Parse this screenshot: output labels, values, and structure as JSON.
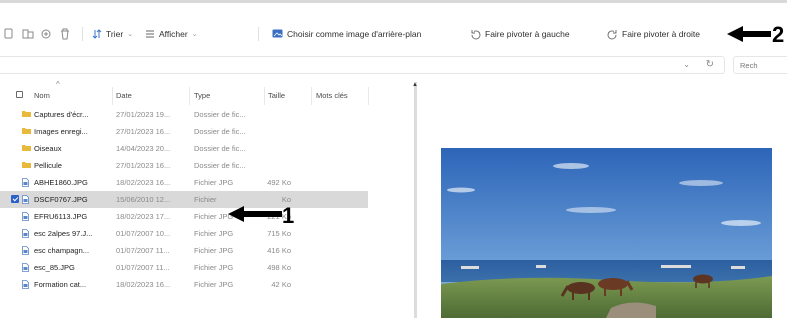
{
  "toolbar": {
    "sort_label": "Trier",
    "view_label": "Afficher",
    "set_background_label": "Choisir comme image d'arrière-plan",
    "rotate_left_label": "Faire pivoter à gauche",
    "rotate_right_label": "Faire pivoter à droite"
  },
  "search": {
    "placeholder": "Rech"
  },
  "columns": {
    "name": "Nom",
    "date": "Date",
    "type": "Type",
    "size": "Taille",
    "tags": "Mots clés"
  },
  "files": [
    {
      "name": "Captures d'écr...",
      "date": "27/01/2023 19...",
      "type": "Dossier de fic...",
      "size": "",
      "kind": "folder"
    },
    {
      "name": "Images enregi...",
      "date": "27/01/2023 16...",
      "type": "Dossier de fic...",
      "size": "",
      "kind": "folder"
    },
    {
      "name": "Oiseaux",
      "date": "14/04/2023 20...",
      "type": "Dossier de fic...",
      "size": "",
      "kind": "folder"
    },
    {
      "name": "Pellicule",
      "date": "27/01/2023 16...",
      "type": "Dossier de fic...",
      "size": "",
      "kind": "folder"
    },
    {
      "name": "ABHE1860.JPG",
      "date": "18/02/2023 16...",
      "type": "Fichier JPG",
      "size": "492 Ko",
      "kind": "file"
    },
    {
      "name": "DSCF0767.JPG",
      "date": "15/06/2010 12...",
      "type": "Fichier",
      "size": "Ko",
      "kind": "file",
      "selected": true
    },
    {
      "name": "EFRU6113.JPG",
      "date": "18/02/2023 17...",
      "type": "Fichier JPG",
      "size": "221 Ko",
      "kind": "file"
    },
    {
      "name": "esc 2alpes 97.J...",
      "date": "01/07/2007 10...",
      "type": "Fichier JPG",
      "size": "715 Ko",
      "kind": "file"
    },
    {
      "name": "esc champagn...",
      "date": "01/07/2007 11...",
      "type": "Fichier JPG",
      "size": "416 Ko",
      "kind": "file"
    },
    {
      "name": "esc_85.JPG",
      "date": "01/07/2007 11...",
      "type": "Fichier JPG",
      "size": "498 Ko",
      "kind": "file"
    },
    {
      "name": "Formation cat...",
      "date": "18/02/2023 16...",
      "type": "Fichier JPG",
      "size": "42 Ko",
      "kind": "file"
    }
  ],
  "annotations": {
    "arrow1": "1",
    "arrow2": "2"
  },
  "colors": {
    "folder": "#e8b93a",
    "selection": "#d9d9d9",
    "checkbox": "#2a62c9"
  }
}
